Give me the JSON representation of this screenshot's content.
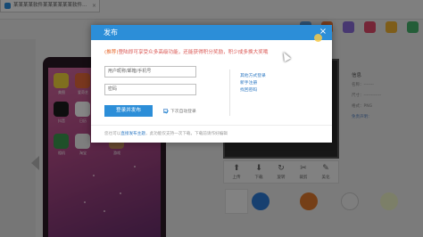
{
  "browser": {
    "tab_title": "某某某某软件某某某某某某软件…",
    "tab_close": "×"
  },
  "dialog": {
    "title": "发布",
    "close_glyph": "×",
    "notice_tag": "(推荐)",
    "notice_text": "登陆即可享受众多高级功能，还能获得积分奖励，积少成多换大奖哦",
    "username_placeholder": "用户昵称/邮箱/手机号",
    "password_placeholder": "密码",
    "login_button": "登录并发布",
    "auto_login_label": "下次自动登录",
    "side_links": [
      "其他方式登录",
      "新手注册",
      "找回密码"
    ],
    "footer_prefix": "您也可以",
    "footer_link": "直接发布主题",
    "footer_suffix": "，此功能仅支持一次下载，下载前请作好编辑"
  },
  "background": {
    "info_title": "信息",
    "info_lines": [
      "名称：-------",
      "尺寸：------------",
      "格式：PNG",
      "免责声明："
    ],
    "tools": [
      {
        "glyph": "⬆",
        "label": "上传"
      },
      {
        "glyph": "⬇",
        "label": "下载"
      },
      {
        "glyph": "↻",
        "label": "旋转"
      },
      {
        "glyph": "✂",
        "label": "裁剪"
      },
      {
        "glyph": "✎",
        "label": "美化"
      }
    ],
    "apps": [
      {
        "label": "美图"
      },
      {
        "label": "抖音"
      },
      {
        "label": "日历"
      },
      {
        "label": "相机"
      },
      {
        "label": "淘宝"
      },
      {
        "label": "爱奇艺"
      },
      {
        "label": "游戏"
      }
    ]
  },
  "colors": {
    "accent": "#2c8ed8",
    "notice": "#d9534f",
    "link": "#2c78c2"
  }
}
